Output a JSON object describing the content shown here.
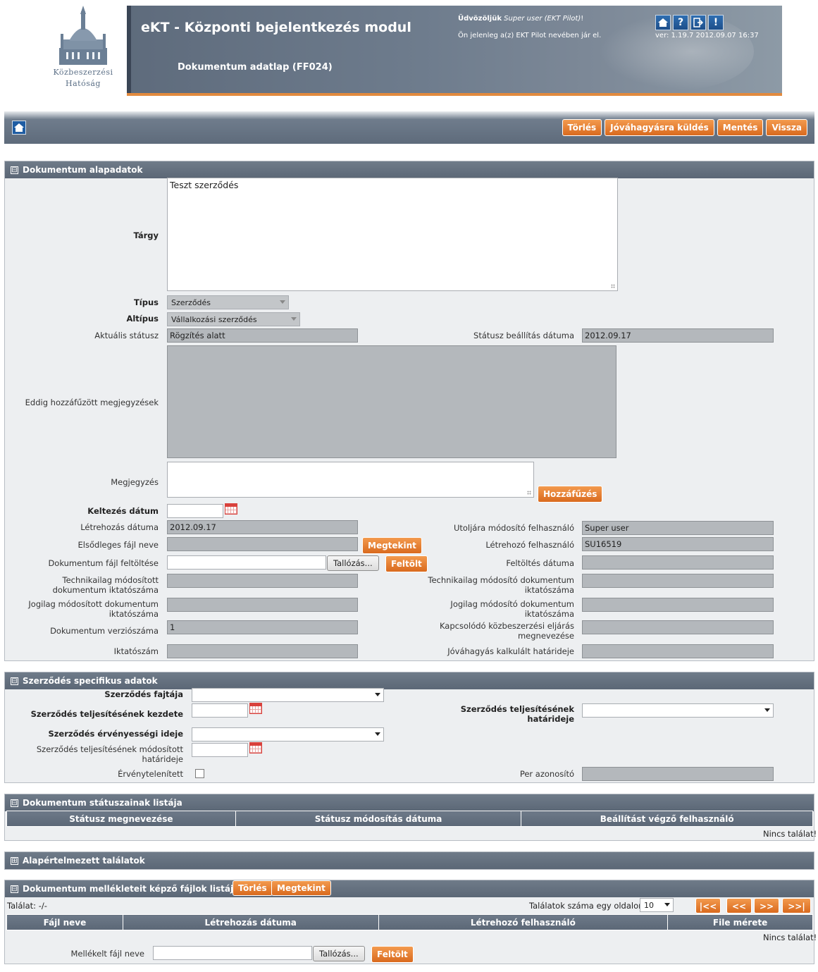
{
  "header": {
    "logo_line1": "Közbeszerzési",
    "logo_line2": "Hatóság",
    "app_title": "eKT - Központi bejelentkezés modul",
    "page_subtitle": "Dokumentum adatlap (FF024)",
    "welcome_prefix": "Üdvözöljük",
    "welcome_user": "Super user (EKT Pilot)",
    "welcome_suffix": "!",
    "pilot_note": "Ön jelenleg a(z) EKT Pilot nevében jár el.",
    "version": "ver: 1.19.7 2012.09.07 16:37",
    "icons": [
      "home-icon",
      "help-icon",
      "logout-icon",
      "alert-icon"
    ],
    "help_glyph": "?",
    "alert_glyph": "!"
  },
  "toolbar": {
    "delete_label": "Törlés",
    "approve_label": "Jóváhagyásra küldés",
    "save_label": "Mentés",
    "back_label": "Vissza"
  },
  "doc_basic": {
    "title": "Dokumentum alapadatok",
    "collapse_glyph": "⊟",
    "targy_label": "Tárgy",
    "targy_value": "Teszt szerződés",
    "tipus_label": "Típus",
    "tipus_value": "Szerződés",
    "altipus_label": "Altípus",
    "altipus_value": "Vállalkozási szerződés",
    "status_label": "Aktuális státusz",
    "status_value": "Rögzítés alatt",
    "status_date_label": "Státusz beállítás dátuma",
    "status_date_value": "2012.09.17",
    "prev_notes_label": "Eddig hozzáfűzött megjegyzések",
    "note_label": "Megjegyzés",
    "append_label": "Hozzáfűzés",
    "keltezes_label": "Keltezés dátum",
    "created_label": "Létrehozás dátuma",
    "created_value": "2012.09.17",
    "last_modifier_label": "Utoljára módosító felhasználó",
    "last_modifier_value": "Super user",
    "primary_file_label": "Elsődleges fájl neve",
    "view_label": "Megtekint",
    "creator_label": "Létrehozó felhasználó",
    "creator_value": "SU16519",
    "upload_label": "Dokumentum fájl feltöltése",
    "browse_label": "Tallózás...",
    "upload_btn_label": "Feltölt",
    "upload_date_label": "Feltöltés dátuma",
    "tech_mod_label": "Technikailag módosított dokumentum iktatószáma",
    "tech_modifier_label": "Technikailag módosító dokumentum iktatószáma",
    "legal_mod_label": "Jogilag módosított dokumentum iktatószáma",
    "legal_modifier_label": "Jogilag módosító dokumentum iktatószáma",
    "version_label": "Dokumentum verziószáma",
    "version_value": "1",
    "related_proc_label": "Kapcsolódó közbeszerzési eljárás megnevezése",
    "iktato_label": "Iktatószám",
    "approval_deadline_label": "Jóváhagyás kalkulált határideje"
  },
  "contract": {
    "title": "Szerződés specifikus adatok",
    "collapse_glyph": "⊟",
    "kind_label": "Szerződés fajtája",
    "start_label": "Szerződés teljesítésének kezdete",
    "deadline_label": "Szerződés teljesítésének határideje",
    "validity_label": "Szerződés érvényességi ideje",
    "modified_deadline_label": "Szerződés teljesítésének módosított határideje",
    "invalidated_label": "Érvénytelenített",
    "lawsuit_label": "Per azonosító"
  },
  "status_list": {
    "title": "Dokumentum státuszainak listája",
    "collapse_glyph": "⊟",
    "columns": [
      "Státusz megnevezése",
      "Státusz módosítás dátuma",
      "Beállítást végző felhasználó"
    ],
    "no_results": "Nincs találat!"
  },
  "default_results": {
    "title": "Alapértelmezett találatok",
    "expand_glyph": "⊞"
  },
  "attachments": {
    "title": "Dokumentum mellékleteit képző fájlok listája",
    "collapse_glyph": "⊟",
    "delete_label": "Törlés",
    "view_label": "Megtekint",
    "hits_label": "Találat: -/-",
    "per_page_label": "Találatok száma egy oldalon",
    "per_page_value": "10",
    "pager": [
      "|<<",
      "<<",
      ">>",
      ">>|"
    ],
    "columns": [
      "Fájl neve",
      "Létrehozás dátuma",
      "Létrehozó felhasználó",
      "File mérete"
    ],
    "no_results": "Nincs találat!",
    "file_name_label": "Mellékelt fájl neve",
    "browse_label": "Tallózás...",
    "upload_label": "Feltölt"
  }
}
